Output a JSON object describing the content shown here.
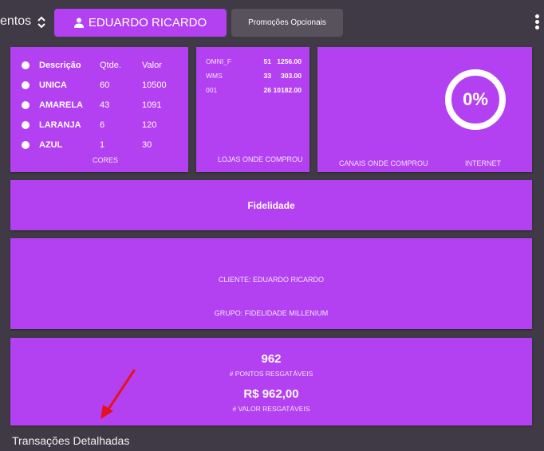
{
  "topbar": {
    "truncated_label": "entos",
    "sort_icon": "sort-updown-icon",
    "user_button_label": "EDUARDO RICARDO",
    "user_icon": "user-icon",
    "promo_button_label": "Promoções Opcionais",
    "menu_icon": "kebab-menu-icon"
  },
  "colors_card": {
    "headers": {
      "desc": "Descrição",
      "qty": "Qtde.",
      "value": "Valor"
    },
    "rows": [
      {
        "desc": "UNICA",
        "qty": "60",
        "value": "10500"
      },
      {
        "desc": "AMARELA",
        "qty": "43",
        "value": "1091"
      },
      {
        "desc": "LARANJA",
        "qty": "6",
        "value": "120"
      },
      {
        "desc": "AZUL",
        "qty": "1",
        "value": "30"
      }
    ],
    "footer": "CORES"
  },
  "stores_card": {
    "rows": [
      {
        "name": "OMNI_F",
        "qty": "51",
        "value": "1256.00"
      },
      {
        "name": "WMS",
        "qty": "33",
        "value": "303.00"
      },
      {
        "name": "001",
        "qty": "26",
        "value": "10182.00"
      }
    ],
    "footer": "LOJAS ONDE COMPROU"
  },
  "channels_card": {
    "percent": "0%",
    "percent_value": 0,
    "footer_left": "CANAIS ONDE COMPROU",
    "footer_right": "INTERNET"
  },
  "fidelity_card": {
    "title": "Fidelidade"
  },
  "client_card": {
    "client": "CLIENTE: EDUARDO RICARDO",
    "group": "GRUPO: FIDELIDADE MILLENIUM"
  },
  "points_card": {
    "points": "962",
    "points_label": "# PONTOS RESGATÁVEIS",
    "value": "R$ 962,00",
    "value_label": "# VALOR RESGATÁVEIS"
  },
  "section_title": "Transações Detalhadas",
  "colors": {
    "accent": "#b341f2",
    "background": "#3f3a45",
    "arrow": "#e5121c"
  }
}
